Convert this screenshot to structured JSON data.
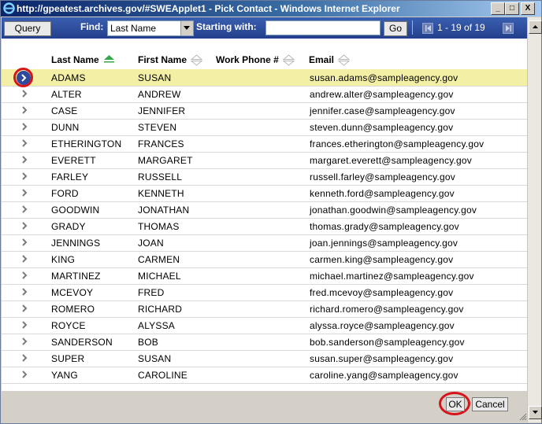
{
  "window": {
    "title": "http://gpeatest.archives.gov/#SWEApplet1 - Pick Contact - Windows Internet Explorer",
    "min_label": "_",
    "max_label": "□",
    "close_label": "X"
  },
  "toolbar": {
    "query_label": "Query",
    "find_label": "Find:",
    "find_value": "Last Name",
    "starting_label": "Starting with:",
    "starting_value": "",
    "go_label": "Go",
    "page_count": "1 - 19 of 19"
  },
  "columns": {
    "last_name": "Last Name",
    "first_name": "First Name",
    "work_phone": "Work Phone #",
    "email": "Email"
  },
  "rows": [
    {
      "last": "ADAMS",
      "first": "SUSAN",
      "phone": "",
      "email": "susan.adams@sampleagency.gov",
      "selected": true
    },
    {
      "last": "ALTER",
      "first": "ANDREW",
      "phone": "",
      "email": "andrew.alter@sampleagency.gov"
    },
    {
      "last": "CASE",
      "first": "JENNIFER",
      "phone": "",
      "email": "jennifer.case@sampleagency.gov"
    },
    {
      "last": "DUNN",
      "first": "STEVEN",
      "phone": "",
      "email": "steven.dunn@sampleagency.gov"
    },
    {
      "last": "ETHERINGTON",
      "first": "FRANCES",
      "phone": "",
      "email": "frances.etherington@sampleagency.gov"
    },
    {
      "last": "EVERETT",
      "first": "MARGARET",
      "phone": "",
      "email": "margaret.everett@sampleagency.gov"
    },
    {
      "last": "FARLEY",
      "first": "RUSSELL",
      "phone": "",
      "email": "russell.farley@sampleagency.gov"
    },
    {
      "last": "FORD",
      "first": "KENNETH",
      "phone": "",
      "email": "kenneth.ford@sampleagency.gov"
    },
    {
      "last": "GOODWIN",
      "first": "JONATHAN",
      "phone": "",
      "email": "jonathan.goodwin@sampleagency.gov"
    },
    {
      "last": "GRADY",
      "first": "THOMAS",
      "phone": "",
      "email": "thomas.grady@sampleagency.gov"
    },
    {
      "last": "JENNINGS",
      "first": "JOAN",
      "phone": "",
      "email": "joan.jennings@sampleagency.gov"
    },
    {
      "last": "KING",
      "first": "CARMEN",
      "phone": "",
      "email": "carmen.king@sampleagency.gov"
    },
    {
      "last": "MARTINEZ",
      "first": "MICHAEL",
      "phone": "",
      "email": "michael.martinez@sampleagency.gov"
    },
    {
      "last": "MCEVOY",
      "first": "FRED",
      "phone": "",
      "email": "fred.mcevoy@sampleagency.gov"
    },
    {
      "last": "ROMERO",
      "first": "RICHARD",
      "phone": "",
      "email": "richard.romero@sampleagency.gov"
    },
    {
      "last": "ROYCE",
      "first": "ALYSSA",
      "phone": "",
      "email": "alyssa.royce@sampleagency.gov"
    },
    {
      "last": "SANDERSON",
      "first": "BOB",
      "phone": "",
      "email": "bob.sanderson@sampleagency.gov"
    },
    {
      "last": "SUPER",
      "first": "SUSAN",
      "phone": "",
      "email": "susan.super@sampleagency.gov"
    },
    {
      "last": "YANG",
      "first": "CAROLINE",
      "phone": "",
      "email": "caroline.yang@sampleagency.gov"
    }
  ],
  "footer": {
    "ok_label": "OK",
    "cancel_label": "Cancel"
  },
  "colors": {
    "toolbar": "#233f8c",
    "selected_row": "#f3f0a6",
    "annotation_ring": "#d7141a",
    "sort_active": "#3aa64c"
  },
  "icons": {
    "browser": "internet-explorer-icon",
    "row_selector": "chevron-right-icon",
    "sort": "sort-arrows-icon"
  }
}
